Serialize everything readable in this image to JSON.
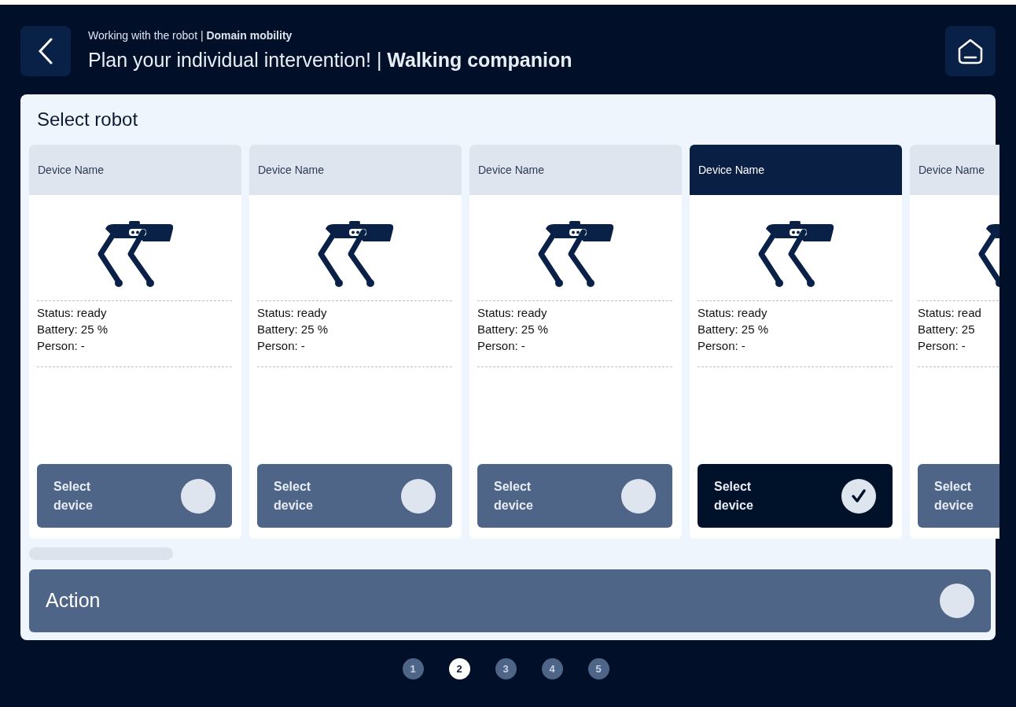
{
  "header": {
    "breadcrumb": "Working with the robot | **Domain mobility**",
    "title": "Plan your individual intervention! | **Walking companion**"
  },
  "section": {
    "title": "Select robot"
  },
  "cards": [
    {
      "name": "Device Name",
      "lines": [
        "Status: ready",
        "Battery: 25 %",
        "Person: -"
      ],
      "button": "Select device",
      "selected": false
    },
    {
      "name": "Device Name",
      "lines": [
        "Status: ready",
        "Battery: 25 %",
        "Person: -"
      ],
      "button": "Select device",
      "selected": false
    },
    {
      "name": "Device Name",
      "lines": [
        "Status: ready",
        "Battery: 25 %",
        "Person: -"
      ],
      "button": "Select device",
      "selected": false
    },
    {
      "name": "Device Name",
      "lines": [
        "Status: ready",
        "Battery: 25 %",
        "Person: -"
      ],
      "button": "Select device",
      "selected": true
    },
    {
      "name": "Device Name",
      "lines": [
        "Status: read",
        "Battery: 25",
        "Person: -"
      ],
      "button": "Select device",
      "selected": false
    }
  ],
  "action": {
    "label": "Action",
    "selected": false
  },
  "pages": [
    {
      "label": "1",
      "selected": false
    },
    {
      "label": "2",
      "selected": true
    },
    {
      "label": "3",
      "selected": false
    },
    {
      "label": "4",
      "selected": false
    },
    {
      "label": "5",
      "selected": false
    }
  ]
}
